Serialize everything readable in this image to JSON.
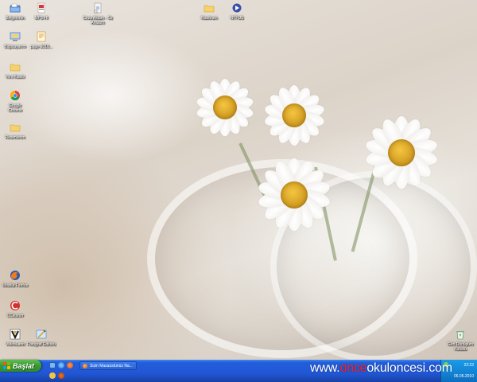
{
  "desktop": {
    "icons": [
      {
        "id": "belgelerim",
        "label": "Belgelerim",
        "icon": "my-documents-icon"
      },
      {
        "id": "mpdf",
        "label": "MP3-HI",
        "icon": "media-file-icon"
      },
      {
        "id": "ceza-aklam",
        "label": "Ceza Aklam - Öz Anlatım",
        "icon": "shortcut-file-icon"
      },
      {
        "id": "klasorum",
        "label": "Klasörum",
        "icon": "folder-icon"
      },
      {
        "id": "ntfus",
        "label": "NTFUS",
        "icon": "media-player-icon"
      },
      {
        "id": "bilgisayarim",
        "label": "Bilgisayarım",
        "icon": "my-computer-icon"
      },
      {
        "id": "pagedoc",
        "label": "page-2010...",
        "icon": "document-icon"
      },
      {
        "id": "yeni-klasor",
        "label": "Yeni Klasör",
        "icon": "folder-icon"
      },
      {
        "id": "google-chrome",
        "label": "Google Chrome",
        "icon": "chrome-icon"
      },
      {
        "id": "resimlerim",
        "label": "Resimlerim",
        "icon": "folder-icon"
      },
      {
        "id": "mozilla-firefox",
        "label": "Mozilla Firefox",
        "icon": "firefox-icon"
      },
      {
        "id": "ccleaner",
        "label": "CCleaner",
        "icon": "ccleaner-icon"
      },
      {
        "id": "videoland",
        "label": "VideoLand",
        "icon": "video-app-icon"
      },
      {
        "id": "fotograf",
        "label": "Fotoğraf Editörü",
        "icon": "photo-editor-icon"
      },
      {
        "id": "geri-donusum",
        "label": "Geri Dönüşüm Kutusu",
        "icon": "recycle-bin-icon"
      }
    ]
  },
  "taskbar": {
    "start_label": "Başlat",
    "quicklaunch": [
      "show-desktop-icon",
      "internet-explorer-icon",
      "firefox-icon",
      "media-icon",
      "browser-icon"
    ],
    "task_button_label": "Sizin Masaüstünüz Na...",
    "clock": "22:22",
    "date": "06.06.2010"
  },
  "watermark": {
    "prefix": "www.",
    "highlight": "once",
    "suffix": "okuloncesi.com"
  },
  "colors": {
    "taskbar_blue": "#245edb",
    "start_green": "#3a9a30",
    "tray_blue": "#1283d4",
    "watermark_red": "#ff2020",
    "daisy_center": "#d6a126"
  }
}
